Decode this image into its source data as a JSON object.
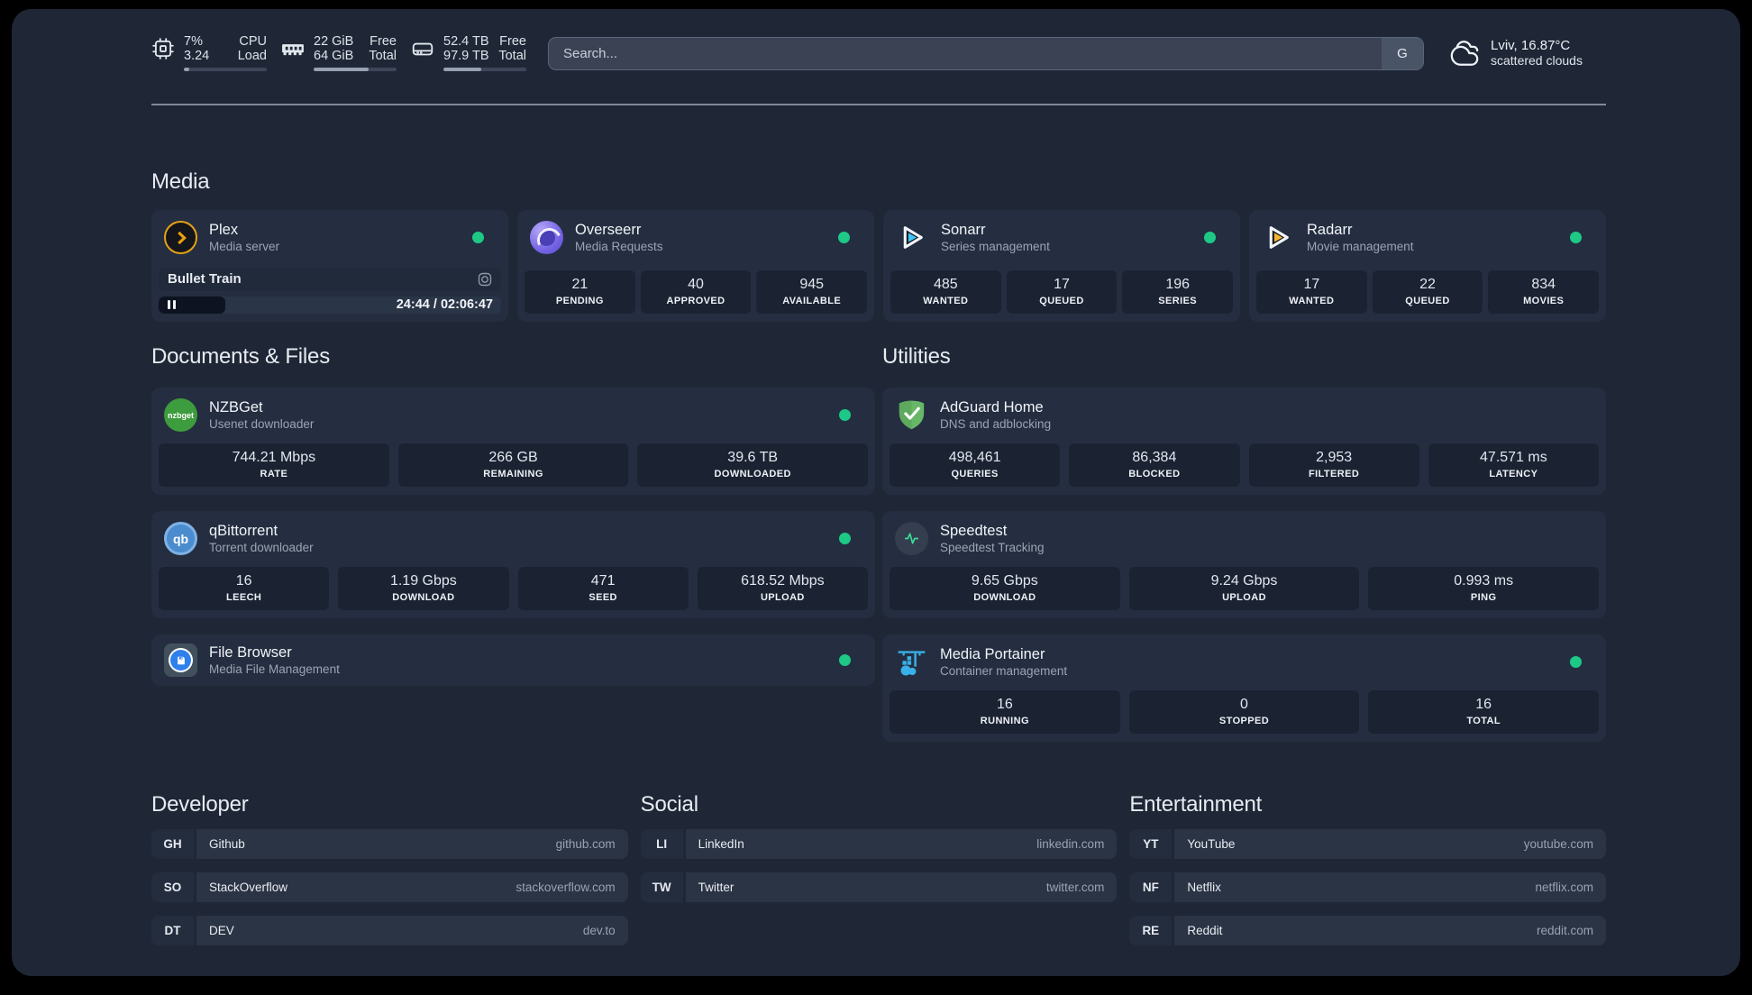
{
  "topbar": {
    "cpu": {
      "value_top": "7%",
      "value_bottom": "3.24",
      "label_top": "CPU",
      "label_bottom": "Load",
      "progress_pct": 7
    },
    "memory": {
      "value_top": "22 GiB",
      "value_bottom": "64 GiB",
      "label_top": "Free",
      "label_bottom": "Total",
      "progress_pct": 66
    },
    "disk": {
      "value_top": "52.4 TB",
      "value_bottom": "97.9 TB",
      "label_top": "Free",
      "label_bottom": "Total",
      "progress_pct": 46
    },
    "search": {
      "placeholder": "Search...",
      "engine_button": "G"
    },
    "weather": {
      "location_temp": "Lviv, 16.87°C",
      "condition": "scattered clouds"
    }
  },
  "sections": {
    "media": {
      "title": "Media",
      "plex": {
        "name": "Plex",
        "desc": "Media server",
        "now_playing": "Bullet Train",
        "time_display": "24:44 / 02:06:47",
        "progress_pct": 19.5
      },
      "overseerr": {
        "name": "Overseerr",
        "desc": "Media Requests",
        "stats": [
          {
            "value": "21",
            "label": "PENDING"
          },
          {
            "value": "40",
            "label": "APPROVED"
          },
          {
            "value": "945",
            "label": "AVAILABLE"
          }
        ]
      },
      "sonarr": {
        "name": "Sonarr",
        "desc": "Series management",
        "stats": [
          {
            "value": "485",
            "label": "WANTED"
          },
          {
            "value": "17",
            "label": "QUEUED"
          },
          {
            "value": "196",
            "label": "SERIES"
          }
        ]
      },
      "radarr": {
        "name": "Radarr",
        "desc": "Movie management",
        "stats": [
          {
            "value": "17",
            "label": "WANTED"
          },
          {
            "value": "22",
            "label": "QUEUED"
          },
          {
            "value": "834",
            "label": "MOVIES"
          }
        ]
      }
    },
    "documents": {
      "title": "Documents & Files",
      "nzbget": {
        "name": "NZBGet",
        "desc": "Usenet downloader",
        "icon_text": "nzbget",
        "stats": [
          {
            "value": "744.21 Mbps",
            "label": "RATE"
          },
          {
            "value": "266 GB",
            "label": "REMAINING"
          },
          {
            "value": "39.6 TB",
            "label": "DOWNLOADED"
          }
        ]
      },
      "qbittorrent": {
        "name": "qBittorrent",
        "desc": "Torrent downloader",
        "icon_text": "qb",
        "stats": [
          {
            "value": "16",
            "label": "LEECH"
          },
          {
            "value": "1.19 Gbps",
            "label": "DOWNLOAD"
          },
          {
            "value": "471",
            "label": "SEED"
          },
          {
            "value": "618.52 Mbps",
            "label": "UPLOAD"
          }
        ]
      },
      "filebrowser": {
        "name": "File Browser",
        "desc": "Media File Management"
      }
    },
    "utilities": {
      "title": "Utilities",
      "adguard": {
        "name": "AdGuard Home",
        "desc": "DNS and adblocking",
        "stats": [
          {
            "value": "498,461",
            "label": "QUERIES"
          },
          {
            "value": "86,384",
            "label": "BLOCKED"
          },
          {
            "value": "2,953",
            "label": "FILTERED"
          },
          {
            "value": "47.571 ms",
            "label": "LATENCY"
          }
        ]
      },
      "speedtest": {
        "name": "Speedtest",
        "desc": "Speedtest Tracking",
        "stats": [
          {
            "value": "9.65 Gbps",
            "label": "DOWNLOAD"
          },
          {
            "value": "9.24 Gbps",
            "label": "UPLOAD"
          },
          {
            "value": "0.993 ms",
            "label": "PING"
          }
        ]
      },
      "portainer": {
        "name": "Media Portainer",
        "desc": "Container management",
        "stats": [
          {
            "value": "16",
            "label": "RUNNING"
          },
          {
            "value": "0",
            "label": "STOPPED"
          },
          {
            "value": "16",
            "label": "TOTAL"
          }
        ]
      }
    }
  },
  "bookmarks": {
    "developer": {
      "title": "Developer",
      "items": [
        {
          "abbr": "GH",
          "name": "Github",
          "url": "github.com"
        },
        {
          "abbr": "SO",
          "name": "StackOverflow",
          "url": "stackoverflow.com"
        },
        {
          "abbr": "DT",
          "name": "DEV",
          "url": "dev.to"
        }
      ]
    },
    "social": {
      "title": "Social",
      "items": [
        {
          "abbr": "LI",
          "name": "LinkedIn",
          "url": "linkedin.com"
        },
        {
          "abbr": "TW",
          "name": "Twitter",
          "url": "twitter.com"
        }
      ]
    },
    "entertainment": {
      "title": "Entertainment",
      "items": [
        {
          "abbr": "YT",
          "name": "YouTube",
          "url": "youtube.com"
        },
        {
          "abbr": "NF",
          "name": "Netflix",
          "url": "netflix.com"
        },
        {
          "abbr": "RE",
          "name": "Reddit",
          "url": "reddit.com"
        }
      ]
    }
  }
}
